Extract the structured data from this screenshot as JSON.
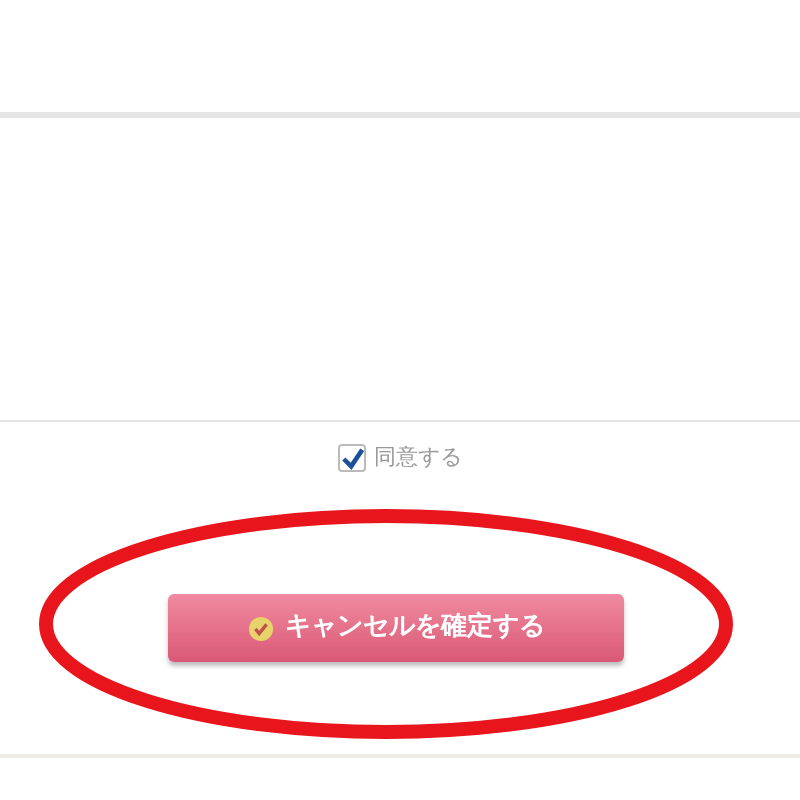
{
  "agree": {
    "label": "同意する",
    "checked": true
  },
  "button": {
    "label": "キャンセルを確定する"
  },
  "annotation": {
    "kind": "ellipse"
  }
}
